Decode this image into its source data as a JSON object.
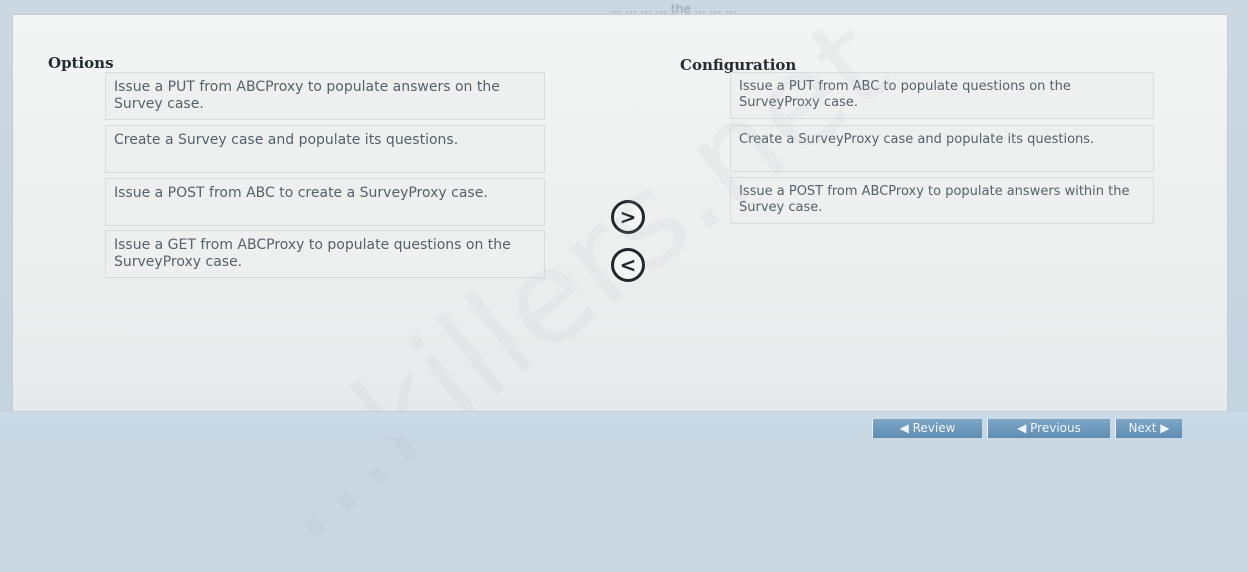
{
  "header": {
    "partial_text": "... ... ... ... the ... ... ..."
  },
  "options": {
    "heading": "Options",
    "items": [
      "Issue a PUT from ABCProxy to populate answers on the Survey case.",
      "Create a Survey case and populate its questions.",
      "Issue a POST from ABC to create a SurveyProxy case.",
      "Issue a GET from ABCProxy to populate questions on the SurveyProxy case."
    ]
  },
  "configuration": {
    "heading": "Configuration",
    "items": [
      "Issue a PUT from ABC to populate questions on the SurveyProxy case.",
      "Create a SurveyProxy case and populate its questions.",
      "Issue a POST from ABCProxy to populate answers within the Survey case."
    ]
  },
  "controls": {
    "move_right": ">",
    "move_left": "<"
  },
  "footer": {
    "review": "Review",
    "previous": "Previous",
    "next": "Next"
  },
  "watermark": "...killers.net",
  "colors": {
    "panel": "#eceeee",
    "footer": "#c6d7e3",
    "button": "#6d97bb",
    "text": "#55616a"
  }
}
